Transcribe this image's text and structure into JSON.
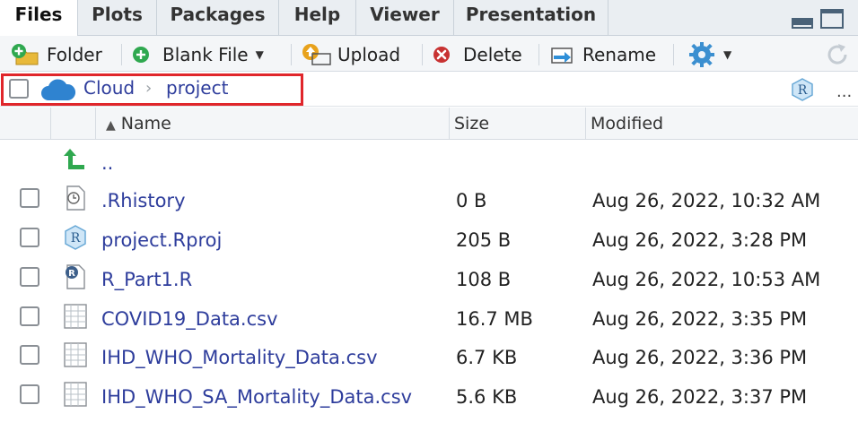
{
  "tabs": [
    {
      "label": "Files"
    },
    {
      "label": "Plots"
    },
    {
      "label": "Packages"
    },
    {
      "label": "Help"
    },
    {
      "label": "Viewer"
    },
    {
      "label": "Presentation"
    }
  ],
  "toolbar": {
    "folder_label": "Folder",
    "blank_file_label": "Blank File",
    "upload_label": "Upload",
    "delete_label": "Delete",
    "rename_label": "Rename"
  },
  "breadcrumb": {
    "items": [
      {
        "label": "Cloud"
      },
      {
        "label": "project"
      }
    ],
    "more_label": "..."
  },
  "table": {
    "columns": [
      {
        "label": "Name"
      },
      {
        "label": "Size"
      },
      {
        "label": "Modified"
      }
    ],
    "parent_label": "..",
    "rows": [
      {
        "name": ".Rhistory",
        "size": "0 B",
        "modified": "Aug 26, 2022, 10:32 AM",
        "icon": "history-file-icon"
      },
      {
        "name": "project.Rproj",
        "size": "205 B",
        "modified": "Aug 26, 2022, 3:28 PM",
        "icon": "rproj-file-icon"
      },
      {
        "name": "R_Part1.R",
        "size": "108 B",
        "modified": "Aug 26, 2022, 10:53 AM",
        "icon": "r-script-file-icon"
      },
      {
        "name": "COVID19_Data.csv",
        "size": "16.7 MB",
        "modified": "Aug 26, 2022, 3:35 PM",
        "icon": "csv-file-icon"
      },
      {
        "name": "IHD_WHO_Mortality_Data.csv",
        "size": "6.7 KB",
        "modified": "Aug 26, 2022, 3:36 PM",
        "icon": "csv-file-icon"
      },
      {
        "name": "IHD_WHO_SA_Mortality_Data.csv",
        "size": "5.6 KB",
        "modified": "Aug 26, 2022, 3:37 PM",
        "icon": "csv-file-icon"
      }
    ]
  },
  "colors": {
    "link": "#2e3d9c",
    "highlight_box": "#e0262b",
    "tab_bar": "#eaeef2"
  }
}
